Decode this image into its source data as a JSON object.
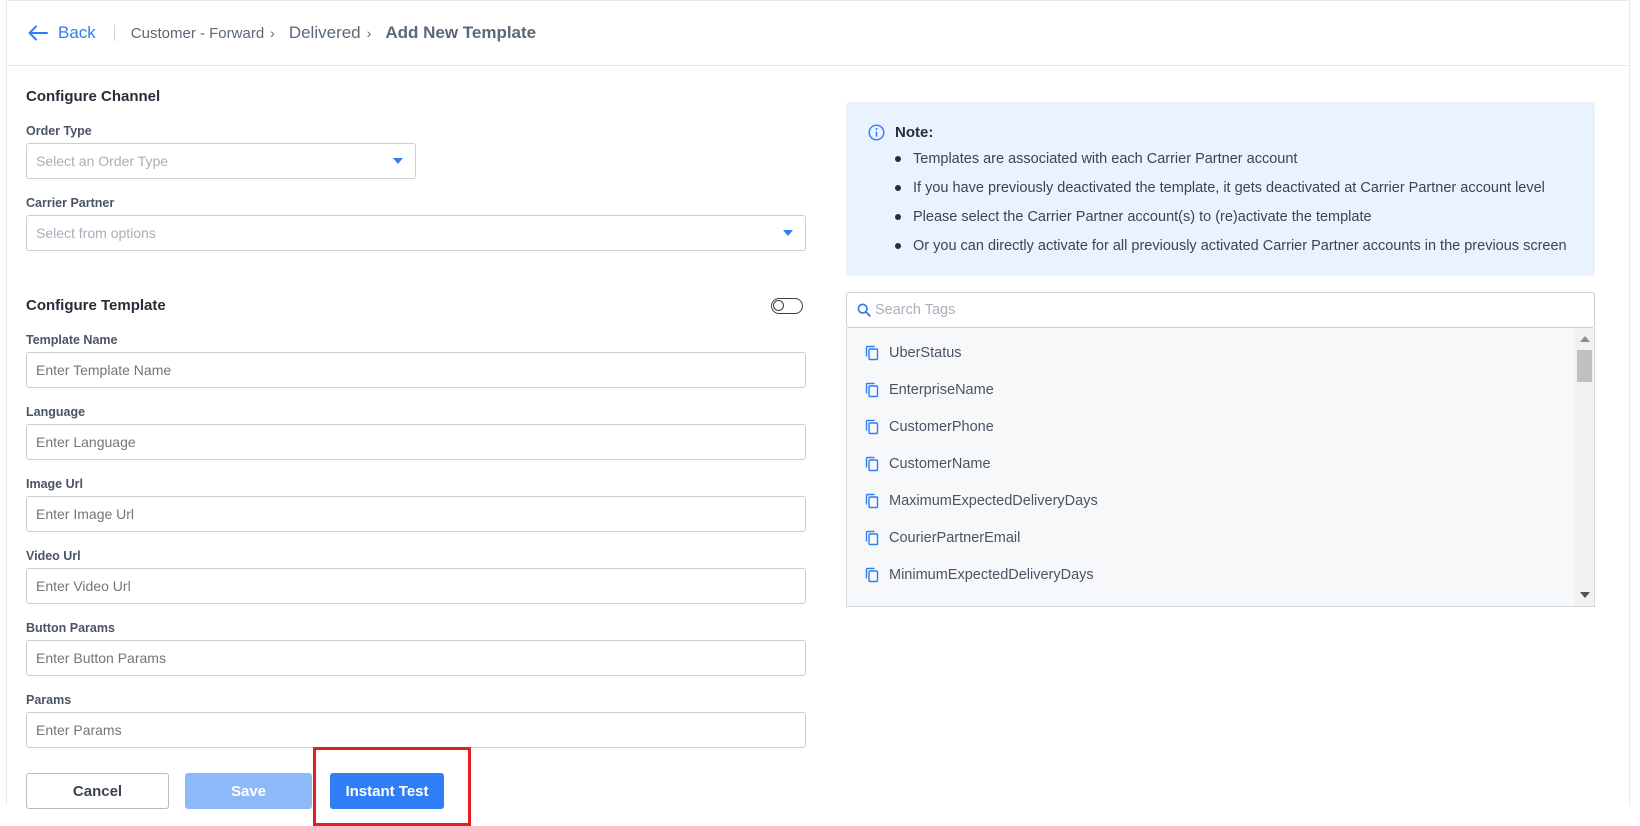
{
  "header": {
    "back_label": "Back",
    "breadcrumb": [
      "Customer - Forward",
      "Delivered",
      "Add New Template"
    ]
  },
  "channel": {
    "title": "Configure Channel",
    "order_type": {
      "label": "Order Type",
      "placeholder": "Select an Order Type"
    },
    "carrier_partner": {
      "label": "Carrier Partner",
      "placeholder": "Select from options"
    }
  },
  "template": {
    "title": "Configure Template",
    "fields": {
      "name": {
        "label": "Template Name",
        "placeholder": "Enter Template Name"
      },
      "language": {
        "label": "Language",
        "placeholder": "Enter Language"
      },
      "image_url": {
        "label": "Image Url",
        "placeholder": "Enter Image Url"
      },
      "video_url": {
        "label": "Video Url",
        "placeholder": "Enter Video Url"
      },
      "button_params": {
        "label": "Button Params",
        "placeholder": "Enter Button Params"
      },
      "params": {
        "label": "Params",
        "placeholder": "Enter Params"
      }
    }
  },
  "actions": {
    "cancel": "Cancel",
    "save": "Save",
    "instant_test": "Instant Test"
  },
  "note": {
    "title": "Note:",
    "items": [
      "Templates are associated with each Carrier Partner account",
      "If you have previously deactivated the template, it gets deactivated at Carrier Partner account level",
      "Please select the Carrier Partner account(s) to (re)activate the template",
      "Or you can directly activate for all previously activated Carrier Partner accounts in the previous screen"
    ]
  },
  "tags": {
    "search_placeholder": "Search Tags",
    "items": [
      "UberStatus",
      "EnterpriseName",
      "CustomerPhone",
      "CustomerName",
      "MaximumExpectedDeliveryDays",
      "CourierPartnerEmail",
      "MinimumExpectedDeliveryDays"
    ]
  },
  "colors": {
    "accent": "#2f7ef5",
    "save_disabled": "#8eb9f8",
    "note_bg": "#eaf2fe",
    "highlight": "#e0211d"
  }
}
